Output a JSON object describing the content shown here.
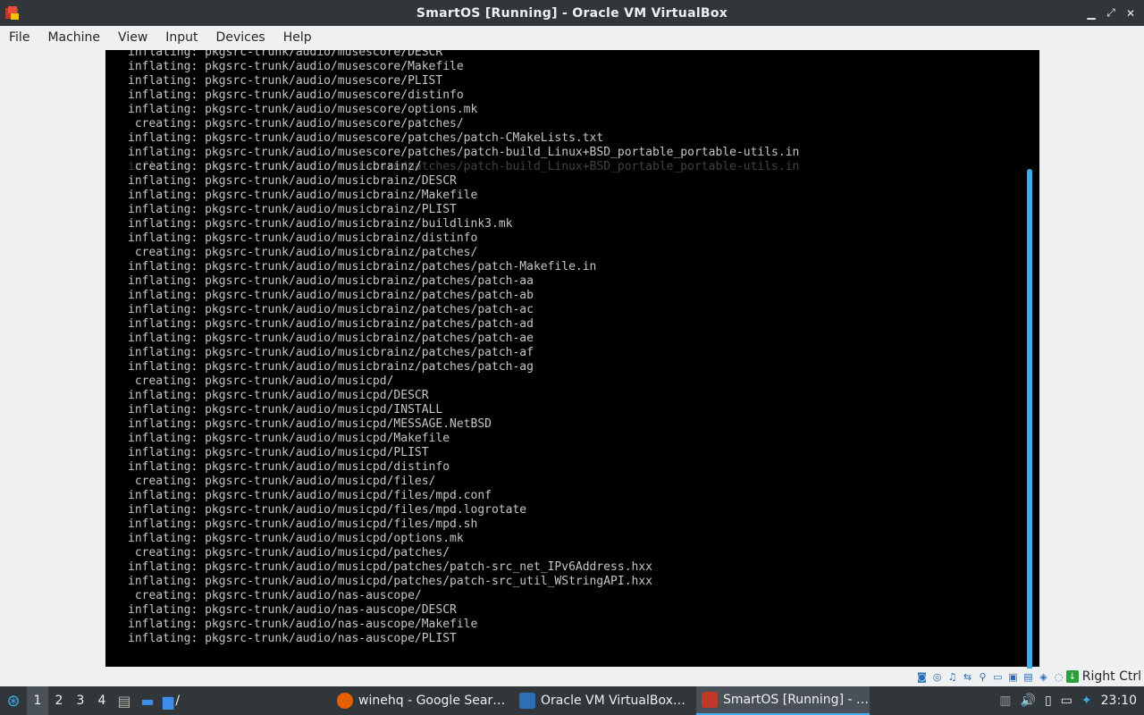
{
  "window": {
    "title": "SmartOS [Running] - Oracle VM VirtualBox",
    "controls": {
      "minimize": "▁",
      "maximize": "⤢",
      "close": "✕"
    }
  },
  "menu": [
    "File",
    "Machine",
    "Input",
    "Devices",
    "Help",
    "View"
  ],
  "menu_order": [
    "File",
    "Machine",
    "View",
    "Input",
    "Devices",
    "Help"
  ],
  "console": {
    "ghost_line": "inflating: pkgsrc-trunk/audio/musescore/patches/patch-build_Linux+BSD_portable_portable-utils.in",
    "lines": [
      "inflating: pkgsrc-trunk/audio/musescore/DESCR",
      "inflating: pkgsrc-trunk/audio/musescore/Makefile",
      "inflating: pkgsrc-trunk/audio/musescore/PLIST",
      "inflating: pkgsrc-trunk/audio/musescore/distinfo",
      "inflating: pkgsrc-trunk/audio/musescore/options.mk",
      " creating: pkgsrc-trunk/audio/musescore/patches/",
      "inflating: pkgsrc-trunk/audio/musescore/patches/patch-CMakeLists.txt",
      "inflating: pkgsrc-trunk/audio/musescore/patches/patch-build_Linux+BSD_portable_portable-utils.in",
      "",
      " creating: pkgsrc-trunk/audio/musicbrainz/",
      "inflating: pkgsrc-trunk/audio/musicbrainz/DESCR",
      "inflating: pkgsrc-trunk/audio/musicbrainz/Makefile",
      "inflating: pkgsrc-trunk/audio/musicbrainz/PLIST",
      "inflating: pkgsrc-trunk/audio/musicbrainz/buildlink3.mk",
      "inflating: pkgsrc-trunk/audio/musicbrainz/distinfo",
      " creating: pkgsrc-trunk/audio/musicbrainz/patches/",
      "inflating: pkgsrc-trunk/audio/musicbrainz/patches/patch-Makefile.in",
      "inflating: pkgsrc-trunk/audio/musicbrainz/patches/patch-aa",
      "inflating: pkgsrc-trunk/audio/musicbrainz/patches/patch-ab",
      "inflating: pkgsrc-trunk/audio/musicbrainz/patches/patch-ac",
      "inflating: pkgsrc-trunk/audio/musicbrainz/patches/patch-ad",
      "inflating: pkgsrc-trunk/audio/musicbrainz/patches/patch-ae",
      "inflating: pkgsrc-trunk/audio/musicbrainz/patches/patch-af",
      "inflating: pkgsrc-trunk/audio/musicbrainz/patches/patch-ag",
      " creating: pkgsrc-trunk/audio/musicpd/",
      "inflating: pkgsrc-trunk/audio/musicpd/DESCR",
      "inflating: pkgsrc-trunk/audio/musicpd/INSTALL",
      "inflating: pkgsrc-trunk/audio/musicpd/MESSAGE.NetBSD",
      "inflating: pkgsrc-trunk/audio/musicpd/Makefile",
      "inflating: pkgsrc-trunk/audio/musicpd/PLIST",
      "inflating: pkgsrc-trunk/audio/musicpd/distinfo",
      " creating: pkgsrc-trunk/audio/musicpd/files/",
      "inflating: pkgsrc-trunk/audio/musicpd/files/mpd.conf",
      "inflating: pkgsrc-trunk/audio/musicpd/files/mpd.logrotate",
      "inflating: pkgsrc-trunk/audio/musicpd/files/mpd.sh",
      "inflating: pkgsrc-trunk/audio/musicpd/options.mk",
      " creating: pkgsrc-trunk/audio/musicpd/patches/",
      "inflating: pkgsrc-trunk/audio/musicpd/patches/patch-src_net_IPv6Address.hxx",
      "inflating: pkgsrc-trunk/audio/musicpd/patches/patch-src_util_WStringAPI.hxx",
      " creating: pkgsrc-trunk/audio/nas-auscope/",
      "inflating: pkgsrc-trunk/audio/nas-auscope/DESCR",
      "inflating: pkgsrc-trunk/audio/nas-auscope/Makefile",
      "inflating: pkgsrc-trunk/audio/nas-auscope/PLIST"
    ]
  },
  "statusbar": {
    "icons": [
      "hard-disk-icon",
      "optical-disk-icon",
      "audio-icon",
      "network-icon",
      "usb-icon",
      "shared-folders-icon",
      "display-icon",
      "video-capture-icon",
      "cpu-icon",
      "mouse-integration-icon"
    ],
    "host_key": "Right Ctrl"
  },
  "taskbar": {
    "workspaces": [
      "1",
      "2",
      "3",
      "4"
    ],
    "active_workspace": "1",
    "folder_path": "/",
    "tasks": [
      {
        "label": "winehq - Google Sear…",
        "icon_color": "#e66000"
      },
      {
        "label": "Oracle VM VirtualBox…",
        "icon_color": "#2f6fb7"
      },
      {
        "label": "SmartOS [Running] - …",
        "icon_color": "#c0392b"
      }
    ],
    "clock": "23:10"
  }
}
